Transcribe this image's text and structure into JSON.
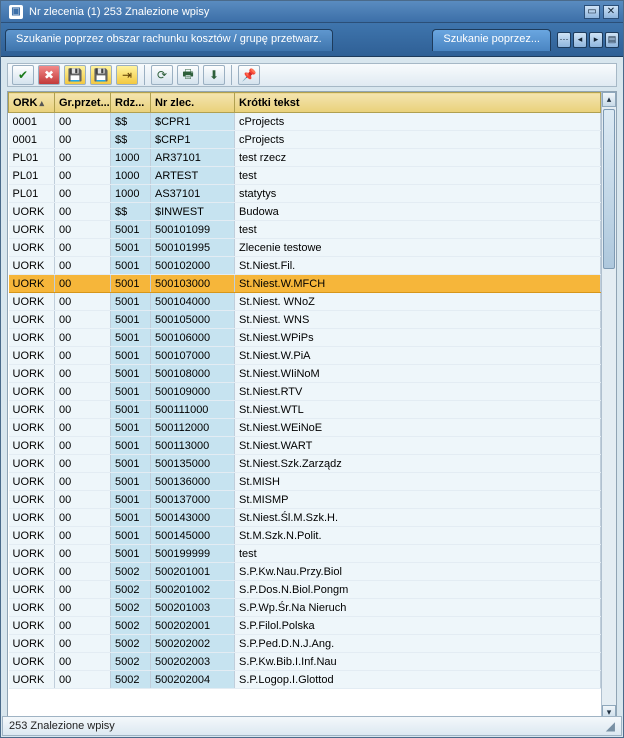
{
  "window": {
    "title": "Nr zlecenia (1)  253 Znalezione wpisy"
  },
  "tabs": {
    "primary": "Szukanie poprzez obszar rachunku kosztów / grupę  przetwarz.",
    "secondary": "Szukanie poprzez..."
  },
  "status": {
    "text": "253 Znalezione wpisy"
  },
  "columns": {
    "ork": "ORK",
    "grp": "Gr.przet...",
    "rdz": "Rdz...",
    "nrz": "Nr zlec.",
    "txt": "Krótki tekst"
  },
  "rows": [
    {
      "ork": "0001",
      "grp": "00",
      "rdz": "$$",
      "nrz": "$CPR1",
      "txt": "cProjects",
      "sel": false
    },
    {
      "ork": "0001",
      "grp": "00",
      "rdz": "$$",
      "nrz": "$CRP1",
      "txt": "cProjects",
      "sel": false
    },
    {
      "ork": "PL01",
      "grp": "00",
      "rdz": "1000",
      "nrz": "AR37101",
      "txt": "test rzecz",
      "sel": false
    },
    {
      "ork": "PL01",
      "grp": "00",
      "rdz": "1000",
      "nrz": "ARTEST",
      "txt": "test",
      "sel": false
    },
    {
      "ork": "PL01",
      "grp": "00",
      "rdz": "1000",
      "nrz": "AS37101",
      "txt": "statytys",
      "sel": false
    },
    {
      "ork": "UORK",
      "grp": "00",
      "rdz": "$$",
      "nrz": "$INWEST",
      "txt": "Budowa",
      "sel": false
    },
    {
      "ork": "UORK",
      "grp": "00",
      "rdz": "5001",
      "nrz": "500101099",
      "txt": "test",
      "sel": false
    },
    {
      "ork": "UORK",
      "grp": "00",
      "rdz": "5001",
      "nrz": "500101995",
      "txt": "Zlecenie testowe",
      "sel": false
    },
    {
      "ork": "UORK",
      "grp": "00",
      "rdz": "5001",
      "nrz": "500102000",
      "txt": "St.Niest.Fil.",
      "sel": false
    },
    {
      "ork": "UORK",
      "grp": "00",
      "rdz": "5001",
      "nrz": "500103000",
      "txt": "St.Niest.W.MFCH",
      "sel": true
    },
    {
      "ork": "UORK",
      "grp": "00",
      "rdz": "5001",
      "nrz": "500104000",
      "txt": "St.Niest. WNoZ",
      "sel": false
    },
    {
      "ork": "UORK",
      "grp": "00",
      "rdz": "5001",
      "nrz": "500105000",
      "txt": "St.Niest. WNS",
      "sel": false
    },
    {
      "ork": "UORK",
      "grp": "00",
      "rdz": "5001",
      "nrz": "500106000",
      "txt": "St.Niest.WPiPs",
      "sel": false
    },
    {
      "ork": "UORK",
      "grp": "00",
      "rdz": "5001",
      "nrz": "500107000",
      "txt": "St.Niest.W.PiA",
      "sel": false
    },
    {
      "ork": "UORK",
      "grp": "00",
      "rdz": "5001",
      "nrz": "500108000",
      "txt": "St.Niest.WIiNoM",
      "sel": false
    },
    {
      "ork": "UORK",
      "grp": "00",
      "rdz": "5001",
      "nrz": "500109000",
      "txt": "St.Niest.RTV",
      "sel": false
    },
    {
      "ork": "UORK",
      "grp": "00",
      "rdz": "5001",
      "nrz": "500111000",
      "txt": "St.Niest.WTL",
      "sel": false
    },
    {
      "ork": "UORK",
      "grp": "00",
      "rdz": "5001",
      "nrz": "500112000",
      "txt": "St.Niest.WEiNoE",
      "sel": false
    },
    {
      "ork": "UORK",
      "grp": "00",
      "rdz": "5001",
      "nrz": "500113000",
      "txt": "St.Niest.WART",
      "sel": false
    },
    {
      "ork": "UORK",
      "grp": "00",
      "rdz": "5001",
      "nrz": "500135000",
      "txt": "St.Niest.Szk.Zarządz",
      "sel": false
    },
    {
      "ork": "UORK",
      "grp": "00",
      "rdz": "5001",
      "nrz": "500136000",
      "txt": "St.MISH",
      "sel": false
    },
    {
      "ork": "UORK",
      "grp": "00",
      "rdz": "5001",
      "nrz": "500137000",
      "txt": "St.MISMP",
      "sel": false
    },
    {
      "ork": "UORK",
      "grp": "00",
      "rdz": "5001",
      "nrz": "500143000",
      "txt": "St.Niest.Śl.M.Szk.H.",
      "sel": false
    },
    {
      "ork": "UORK",
      "grp": "00",
      "rdz": "5001",
      "nrz": "500145000",
      "txt": "St.M.Szk.N.Polit.",
      "sel": false
    },
    {
      "ork": "UORK",
      "grp": "00",
      "rdz": "5001",
      "nrz": "500199999",
      "txt": "test",
      "sel": false
    },
    {
      "ork": "UORK",
      "grp": "00",
      "rdz": "5002",
      "nrz": "500201001",
      "txt": "S.P.Kw.Nau.Przy.Biol",
      "sel": false
    },
    {
      "ork": "UORK",
      "grp": "00",
      "rdz": "5002",
      "nrz": "500201002",
      "txt": "S.P.Dos.N.Biol.Pongm",
      "sel": false
    },
    {
      "ork": "UORK",
      "grp": "00",
      "rdz": "5002",
      "nrz": "500201003",
      "txt": "S.P.Wp.Śr.Na Nieruch",
      "sel": false
    },
    {
      "ork": "UORK",
      "grp": "00",
      "rdz": "5002",
      "nrz": "500202001",
      "txt": "S.P.Filol.Polska",
      "sel": false
    },
    {
      "ork": "UORK",
      "grp": "00",
      "rdz": "5002",
      "nrz": "500202002",
      "txt": "S.P.Ped.D.N.J.Ang.",
      "sel": false
    },
    {
      "ork": "UORK",
      "grp": "00",
      "rdz": "5002",
      "nrz": "500202003",
      "txt": "S.P.Kw.Bib.I.Inf.Nau",
      "sel": false
    },
    {
      "ork": "UORK",
      "grp": "00",
      "rdz": "5002",
      "nrz": "500202004",
      "txt": "S.P.Logop.I.Glottod",
      "sel": false
    }
  ]
}
